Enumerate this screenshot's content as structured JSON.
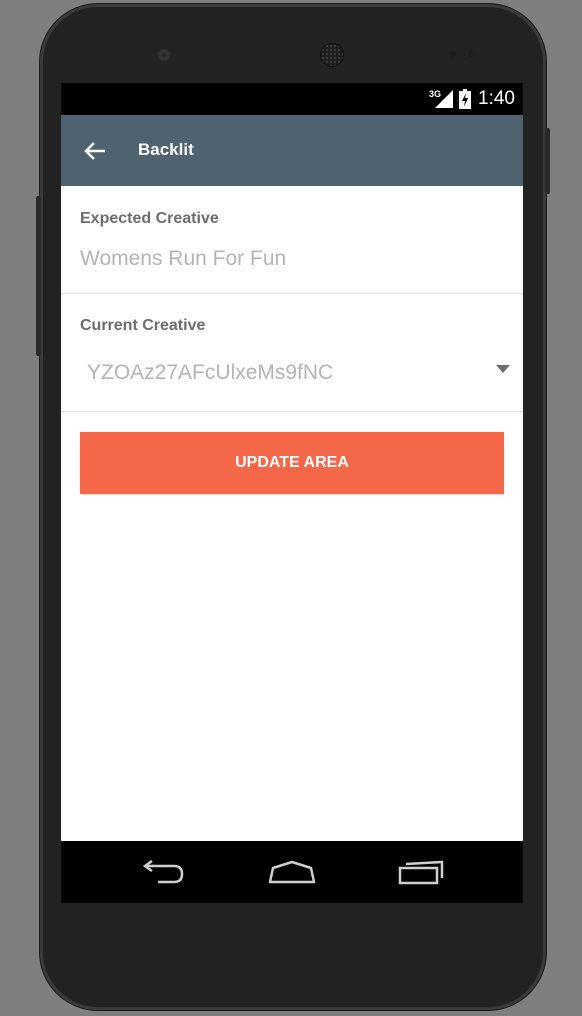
{
  "status_bar": {
    "network": "3G",
    "time": "1:40"
  },
  "toolbar": {
    "title": "Backlit",
    "back_icon": "arrow-back-icon"
  },
  "form": {
    "expected_label": "Expected Creative",
    "expected_value": "Womens Run For Fun",
    "current_label": "Current Creative",
    "current_selected": "YZOAz27AFcUlxeMs9fNC"
  },
  "action": {
    "update_label": "UPDATE AREA"
  },
  "nav_bar": {
    "back_icon": "nav-back-icon",
    "home_icon": "nav-home-icon",
    "recents_icon": "nav-recents-icon"
  },
  "colors": {
    "toolbar": "#4f6270",
    "accent_button": "#f56749",
    "label_text": "#6d6d6d",
    "value_text": "#b4b4b4"
  }
}
